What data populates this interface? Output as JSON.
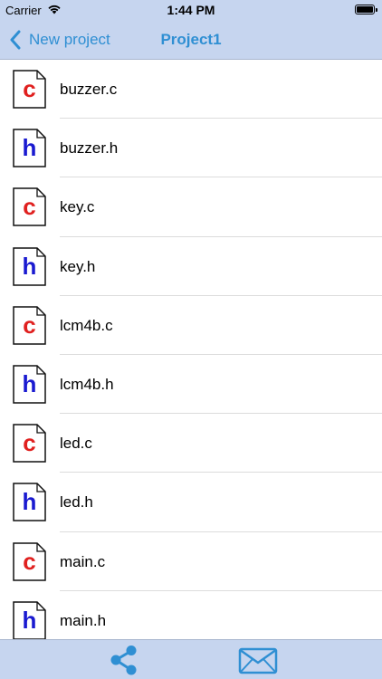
{
  "status": {
    "carrier": "Carrier",
    "time": "1:44 PM"
  },
  "nav": {
    "back_label": "New project",
    "title": "Project1"
  },
  "files": [
    {
      "name": "buzzer.c",
      "type": "c"
    },
    {
      "name": "buzzer.h",
      "type": "h"
    },
    {
      "name": "key.c",
      "type": "c"
    },
    {
      "name": "key.h",
      "type": "h"
    },
    {
      "name": "lcm4b.c",
      "type": "c"
    },
    {
      "name": "lcm4b.h",
      "type": "h"
    },
    {
      "name": "led.c",
      "type": "c"
    },
    {
      "name": "led.h",
      "type": "h"
    },
    {
      "name": "main.c",
      "type": "c"
    },
    {
      "name": "main.h",
      "type": "h"
    }
  ],
  "toolbar": {
    "share_icon": "share-icon",
    "mail_icon": "mail-icon"
  },
  "colors": {
    "bar_background": "#c6d5ef",
    "accent": "#2f8fd3",
    "c_letter": "#e0201f",
    "h_letter": "#1a1ad0"
  }
}
